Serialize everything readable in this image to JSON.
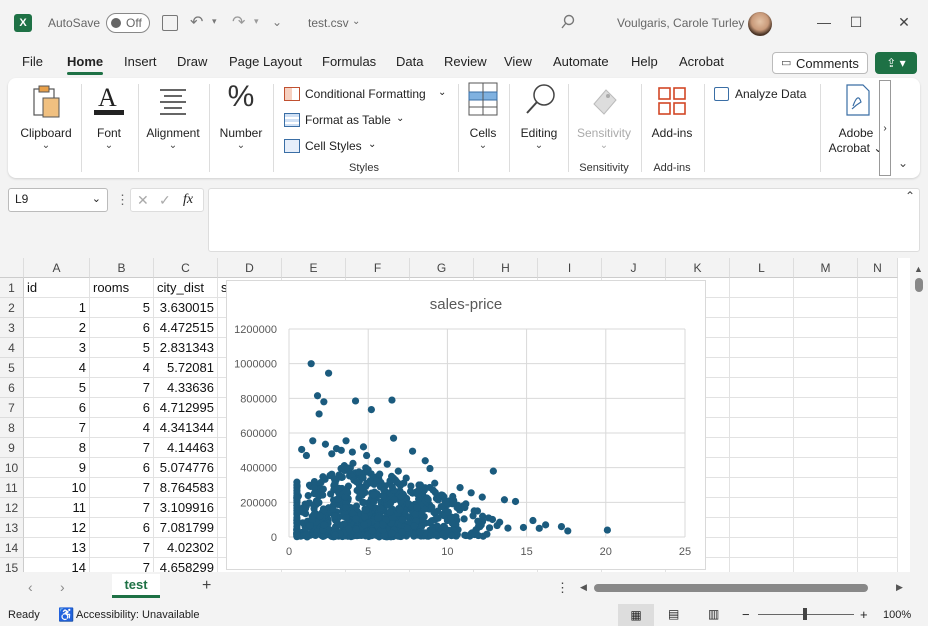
{
  "titlebar": {
    "autosave_label": "AutoSave",
    "autosave_state": "Off",
    "filename": "test.csv",
    "user": "Voulgaris, Carole Turley"
  },
  "menu": {
    "tabs": [
      "File",
      "Home",
      "Insert",
      "Draw",
      "Page Layout",
      "Formulas",
      "Data",
      "Review",
      "View",
      "Automate",
      "Help",
      "Acrobat"
    ],
    "active": "Home",
    "comments_label": "Comments"
  },
  "ribbon": {
    "clipboard": "Clipboard",
    "font": "Font",
    "alignment": "Alignment",
    "number": "Number",
    "conditional_formatting": "Conditional Formatting",
    "format_as_table": "Format as Table",
    "cell_styles": "Cell Styles",
    "styles_group": "Styles",
    "cells": "Cells",
    "editing": "Editing",
    "sensitivity": "Sensitivity",
    "sensitivity_group": "Sensitivity",
    "addins": "Add-ins",
    "addins_group": "Add-ins",
    "analyze_data": "Analyze Data",
    "adobe_acrobat_1": "Adobe",
    "adobe_acrobat_2": "Acrobat"
  },
  "formula_bar": {
    "name_box": "L9",
    "fx": "fx",
    "formula": ""
  },
  "grid": {
    "columns": [
      "A",
      "B",
      "C",
      "D",
      "E",
      "F",
      "G",
      "H",
      "I",
      "J",
      "K",
      "L",
      "M",
      "N"
    ],
    "rows": [
      [
        "1",
        "id",
        "rooms",
        "city_dist",
        "s"
      ],
      [
        "2",
        "1",
        "5",
        "3.630015"
      ],
      [
        "3",
        "2",
        "6",
        "4.472515"
      ],
      [
        "4",
        "3",
        "5",
        "2.831343"
      ],
      [
        "5",
        "4",
        "4",
        "5.72081"
      ],
      [
        "6",
        "5",
        "7",
        "4.33636"
      ],
      [
        "7",
        "6",
        "6",
        "4.712995"
      ],
      [
        "8",
        "7",
        "4",
        "4.341344"
      ],
      [
        "9",
        "8",
        "7",
        "4.14463"
      ],
      [
        "10",
        "9",
        "6",
        "5.074776"
      ],
      [
        "11",
        "10",
        "7",
        "8.764583"
      ],
      [
        "12",
        "11",
        "7",
        "3.109916"
      ],
      [
        "13",
        "12",
        "6",
        "7.081799"
      ],
      [
        "14",
        "13",
        "7",
        "4.02302"
      ],
      [
        "15",
        "14",
        "7",
        "4.658299"
      ]
    ]
  },
  "chart_data": {
    "type": "scatter",
    "title": "sales-price",
    "xlabel": "",
    "ylabel": "",
    "xlim": [
      0,
      25
    ],
    "ylim": [
      0,
      1200000
    ],
    "xticks": [
      "0",
      "5",
      "10",
      "15",
      "20",
      "25"
    ],
    "yticks": [
      "0",
      "200000",
      "400000",
      "600000",
      "800000",
      "1000000",
      "1200000"
    ],
    "grid": true,
    "color": "#1b5b7e",
    "points": [
      [
        1.4,
        1000000
      ],
      [
        2.5,
        945000
      ],
      [
        1.8,
        815000
      ],
      [
        2.2,
        780000
      ],
      [
        4.2,
        785000
      ],
      [
        5.2,
        735000
      ],
      [
        6.5,
        790000
      ],
      [
        1.9,
        710000
      ],
      [
        6.6,
        570000
      ],
      [
        3.6,
        555000
      ],
      [
        1.5,
        555000
      ],
      [
        2.3,
        535000
      ],
      [
        3.0,
        510000
      ],
      [
        0.8,
        505000
      ],
      [
        4.7,
        520000
      ],
      [
        7.8,
        495000
      ],
      [
        8.6,
        440000
      ],
      [
        1.1,
        470000
      ],
      [
        12.9,
        380000
      ],
      [
        8.9,
        395000
      ],
      [
        9.2,
        310000
      ],
      [
        10.8,
        285000
      ],
      [
        11.5,
        255000
      ],
      [
        12.2,
        230000
      ],
      [
        13.6,
        215000
      ],
      [
        14.3,
        205000
      ],
      [
        15.4,
        95000
      ],
      [
        16.2,
        70000
      ],
      [
        17.2,
        60000
      ],
      [
        17.6,
        35000
      ],
      [
        20.1,
        40000
      ],
      [
        15.8,
        50000
      ],
      [
        14.8,
        55000
      ],
      [
        13.3,
        85000
      ],
      [
        12.6,
        110000
      ],
      [
        11.9,
        150000
      ],
      [
        11.1,
        170000
      ],
      [
        10.4,
        210000
      ],
      [
        9.7,
        240000
      ],
      [
        9.1,
        270000
      ],
      [
        8.3,
        300000
      ],
      [
        7.4,
        340000
      ],
      [
        6.9,
        380000
      ],
      [
        6.2,
        420000
      ],
      [
        5.6,
        440000
      ],
      [
        4.9,
        470000
      ],
      [
        4.0,
        490000
      ],
      [
        3.3,
        500000
      ],
      [
        2.7,
        480000
      ]
    ],
    "cluster": {
      "x_center": 5.5,
      "x_spread": 4.5,
      "y_max": 420000
    }
  },
  "sheetbar": {
    "sheet": "test"
  },
  "statusbar": {
    "ready": "Ready",
    "accessibility": "Accessibility: Unavailable",
    "zoom": "100%"
  }
}
